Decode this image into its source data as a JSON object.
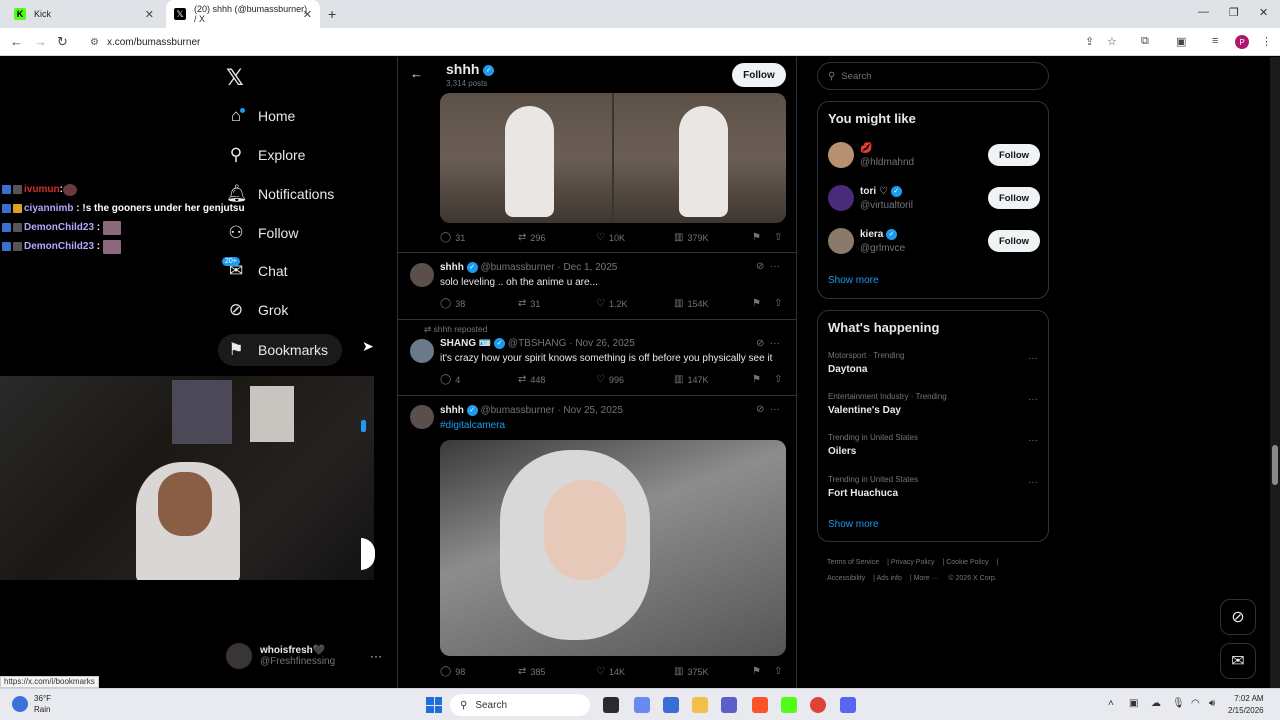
{
  "browser": {
    "tabs": [
      {
        "title": "Kick"
      },
      {
        "title": "(20) shhh (@bumassburner) / X"
      }
    ],
    "url": "x.com/bumassburner",
    "status_url": "https://x.com/i/bookmarks"
  },
  "sidebar": {
    "items": [
      {
        "label": "Home",
        "icon": "home-icon"
      },
      {
        "label": "Explore",
        "icon": "search-icon"
      },
      {
        "label": "Notifications",
        "icon": "bell-icon"
      },
      {
        "label": "Follow",
        "icon": "add-person-icon"
      },
      {
        "label": "Chat",
        "icon": "mail-icon",
        "badge": "20+"
      },
      {
        "label": "Grok",
        "icon": "grok-icon"
      },
      {
        "label": "Bookmarks",
        "icon": "bookmark-icon"
      }
    ],
    "user": {
      "name": "whoisfresh🖤",
      "handle": "@Freshfinessing"
    }
  },
  "chat_overlay": {
    "messages": [
      {
        "user": "ivumun",
        "text": "",
        "color": "#d62b2b"
      },
      {
        "user": "ciyannimb",
        "text": "!s the gooners under her genjutsu",
        "color": "#b6a6ff"
      },
      {
        "user": "DemonChild23",
        "text": "",
        "color": "#b6a6ff"
      },
      {
        "user": "DemonChild23",
        "text": "",
        "color": "#b6a6ff"
      }
    ]
  },
  "profile_header": {
    "name": "shhh",
    "posts_count": "3,314 posts",
    "follow_label": "Follow"
  },
  "posts": [
    {
      "replies": "31",
      "reposts": "296",
      "likes": "10K",
      "views": "379K"
    },
    {
      "name": "shhh",
      "handle": "@bumassburner",
      "date": "Dec 1, 2025",
      "text": "solo leveling .. oh the anime u are...",
      "replies": "38",
      "reposts": "31",
      "likes": "1.2K",
      "views": "154K"
    },
    {
      "repost_label": "shhh reposted",
      "name": "SHANG",
      "handle": "@TBSHANG",
      "date": "Nov 26, 2025",
      "text": "it's crazy how your spirit knows something is off before you physically see it",
      "replies": "4",
      "reposts": "448",
      "likes": "996",
      "views": "147K"
    },
    {
      "name": "shhh",
      "handle": "@bumassburner",
      "date": "Nov 25, 2025",
      "text": "#digitalcamera",
      "replies": "98",
      "reposts": "385",
      "likes": "14K",
      "views": "375K"
    }
  ],
  "right": {
    "search_placeholder": "Search",
    "you_might_like": {
      "title": "You might like",
      "users": [
        {
          "name": "💋",
          "handle": "@hldmahnd",
          "button": "Follow"
        },
        {
          "name": "tori ♡",
          "handle": "@virtualtoril",
          "button": "Follow"
        },
        {
          "name": "kiera",
          "handle": "@grlmvce",
          "button": "Follow"
        }
      ],
      "show_more": "Show more"
    },
    "whats_happening": {
      "title": "What's happening",
      "trends": [
        {
          "context": "Motorsport · Trending",
          "topic": "Daytona"
        },
        {
          "context": "Entertainment Industry · Trending",
          "topic": "Valentine's Day"
        },
        {
          "context": "Trending in United States",
          "topic": "Oilers"
        },
        {
          "context": "Trending in United States",
          "topic": "Fort Huachuca"
        }
      ],
      "show_more": "Show more"
    },
    "footer": {
      "links": [
        "Terms of Service",
        "Privacy Policy",
        "Cookie Policy",
        "Accessibility",
        "Ads info",
        "More ···"
      ],
      "copyright": "© 2026 X Corp."
    }
  },
  "taskbar": {
    "weather_temp": "36°F",
    "weather_cond": "Rain",
    "search_label": "Search",
    "time": "7:02 AM",
    "date": "2/15/2026"
  },
  "colors": {
    "accent": "#1d9bf0",
    "background": "#000000",
    "muted": "#71767b"
  }
}
